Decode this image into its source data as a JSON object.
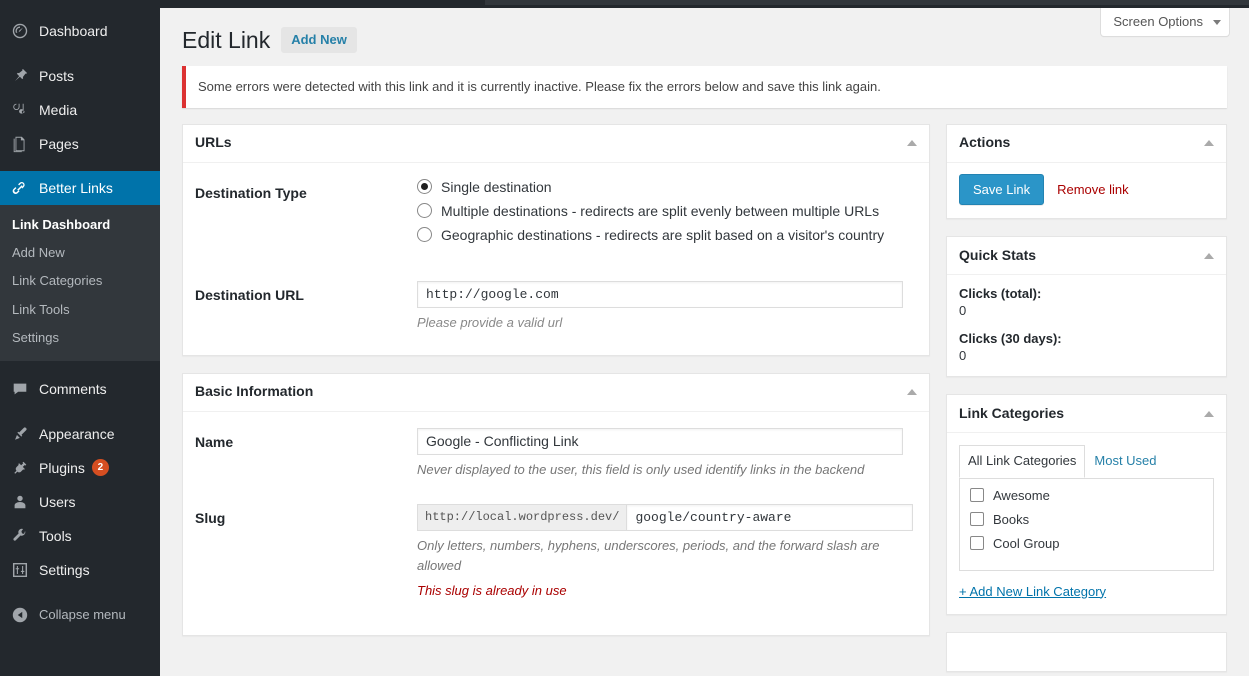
{
  "sidebar": {
    "items": [
      {
        "label": "Dashboard",
        "icon": "dashboard-icon",
        "name": "dashboard"
      },
      {
        "label": "Posts",
        "icon": "pin-icon",
        "name": "posts"
      },
      {
        "label": "Media",
        "icon": "media-icon",
        "name": "media"
      },
      {
        "label": "Pages",
        "icon": "pages-icon",
        "name": "pages"
      },
      {
        "label": "Better Links",
        "icon": "link-icon",
        "name": "better-links",
        "active": true
      },
      {
        "label": "Comments",
        "icon": "comments-icon",
        "name": "comments"
      },
      {
        "label": "Appearance",
        "icon": "brush-icon",
        "name": "appearance"
      },
      {
        "label": "Plugins",
        "icon": "plug-icon",
        "name": "plugins",
        "badge": "2"
      },
      {
        "label": "Users",
        "icon": "user-icon",
        "name": "users"
      },
      {
        "label": "Tools",
        "icon": "wrench-icon",
        "name": "tools"
      },
      {
        "label": "Settings",
        "icon": "sliders-icon",
        "name": "settings"
      }
    ],
    "submenu": [
      {
        "label": "Link Dashboard",
        "current": true
      },
      {
        "label": "Add New"
      },
      {
        "label": "Link Categories"
      },
      {
        "label": "Link Tools"
      },
      {
        "label": "Settings"
      }
    ],
    "collapse": {
      "label": "Collapse menu",
      "icon": "collapse-icon"
    }
  },
  "screen_options": {
    "label": "Screen Options"
  },
  "header": {
    "title": "Edit Link",
    "add_new_label": "Add New"
  },
  "notice": {
    "message": "Some errors were detected with this link and it is currently inactive. Please fix the errors below and save this link again.",
    "color": "#dc3232"
  },
  "urls_panel": {
    "title": "URLs",
    "destination_type_label": "Destination Type",
    "options": [
      {
        "label": "Single destination",
        "checked": true
      },
      {
        "label": "Multiple destinations - redirects are split evenly between multiple URLs",
        "checked": false
      },
      {
        "label": "Geographic destinations - redirects are split based on a visitor's country",
        "checked": false
      }
    ],
    "destination_url_label": "Destination URL",
    "destination_url_value": "http://google.com",
    "destination_url_error": "Please provide a valid url"
  },
  "basic_panel": {
    "title": "Basic Information",
    "name_label": "Name",
    "name_value": "Google - Conflicting Link",
    "name_help": "Never displayed to the user, this field is only used identify links in the backend",
    "slug_label": "Slug",
    "slug_prefix": "http://local.wordpress.dev/",
    "slug_value": "google/country-aware",
    "slug_help": "Only letters, numbers, hyphens, underscores, periods, and the forward slash are allowed",
    "slug_error": "This slug is already in use"
  },
  "actions_panel": {
    "title": "Actions",
    "save_label": "Save Link",
    "remove_label": "Remove link",
    "save_color": "#2b95c8",
    "remove_color": "#a00"
  },
  "quick_stats_panel": {
    "title": "Quick Stats",
    "stats": [
      {
        "label": "Clicks (total):",
        "value": "0"
      },
      {
        "label": "Clicks (30 days):",
        "value": "0"
      }
    ]
  },
  "categories_panel": {
    "title": "Link Categories",
    "tabs": [
      {
        "label": "All Link Categories",
        "active": true
      },
      {
        "label": "Most Used",
        "active": false
      }
    ],
    "items": [
      {
        "label": "Awesome",
        "checked": false
      },
      {
        "label": "Books",
        "checked": false
      },
      {
        "label": "Cool Group",
        "checked": false
      }
    ],
    "add_link_label": "+ Add New Link Category"
  },
  "accent": "#0073aa"
}
